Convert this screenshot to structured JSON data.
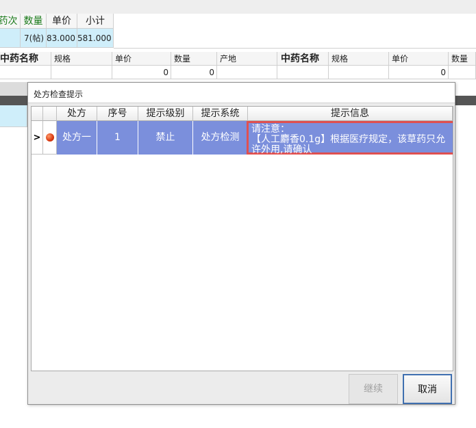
{
  "grid_top": {
    "headers": [
      "药次",
      "数量",
      "单价",
      "小计"
    ],
    "values": [
      "",
      "7(帖)",
      "83.000",
      "581.000"
    ]
  },
  "grid_herb": {
    "headers": [
      "中药名称",
      "规格",
      "单价",
      "数量",
      "产地",
      "中药名称",
      "规格",
      "单价",
      "数量"
    ],
    "row": [
      "",
      "",
      "0",
      "0",
      "",
      "",
      "",
      "0",
      ""
    ]
  },
  "dialog": {
    "title": "处方检查提示",
    "columns": [
      "处方",
      "序号",
      "提示级别",
      "提示系统",
      "提示信息"
    ],
    "rows": [
      {
        "indicator": ">",
        "status_icon": "red-ball-icon",
        "prescription": "处方一",
        "seq": "1",
        "level": "禁止",
        "system": "处方检测",
        "message_line1": "请注意：",
        "message_line2": "【人工麝香0.1g】根据医疗规定，该草药只允许外用,请确认"
      }
    ],
    "buttons": {
      "continue": "继续",
      "cancel": "取消"
    }
  },
  "colors": {
    "selected_row": "#7b8fdc",
    "highlight_border": "#e05050",
    "header_green": "#1a7a1a",
    "cell_blue": "#cfeefa"
  }
}
